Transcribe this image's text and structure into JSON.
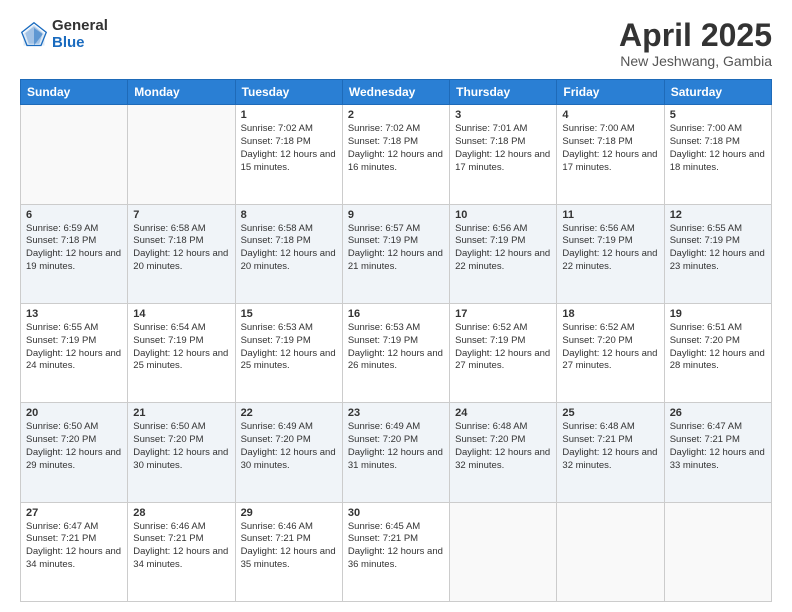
{
  "header": {
    "logo_general": "General",
    "logo_blue": "Blue",
    "month_title": "April 2025",
    "location": "New Jeshwang, Gambia"
  },
  "days_of_week": [
    "Sunday",
    "Monday",
    "Tuesday",
    "Wednesday",
    "Thursday",
    "Friday",
    "Saturday"
  ],
  "weeks": [
    [
      {
        "day": "",
        "sunrise": "",
        "sunset": "",
        "daylight": ""
      },
      {
        "day": "",
        "sunrise": "",
        "sunset": "",
        "daylight": ""
      },
      {
        "day": "1",
        "sunrise": "Sunrise: 7:02 AM",
        "sunset": "Sunset: 7:18 PM",
        "daylight": "Daylight: 12 hours and 15 minutes."
      },
      {
        "day": "2",
        "sunrise": "Sunrise: 7:02 AM",
        "sunset": "Sunset: 7:18 PM",
        "daylight": "Daylight: 12 hours and 16 minutes."
      },
      {
        "day": "3",
        "sunrise": "Sunrise: 7:01 AM",
        "sunset": "Sunset: 7:18 PM",
        "daylight": "Daylight: 12 hours and 17 minutes."
      },
      {
        "day": "4",
        "sunrise": "Sunrise: 7:00 AM",
        "sunset": "Sunset: 7:18 PM",
        "daylight": "Daylight: 12 hours and 17 minutes."
      },
      {
        "day": "5",
        "sunrise": "Sunrise: 7:00 AM",
        "sunset": "Sunset: 7:18 PM",
        "daylight": "Daylight: 12 hours and 18 minutes."
      }
    ],
    [
      {
        "day": "6",
        "sunrise": "Sunrise: 6:59 AM",
        "sunset": "Sunset: 7:18 PM",
        "daylight": "Daylight: 12 hours and 19 minutes."
      },
      {
        "day": "7",
        "sunrise": "Sunrise: 6:58 AM",
        "sunset": "Sunset: 7:18 PM",
        "daylight": "Daylight: 12 hours and 20 minutes."
      },
      {
        "day": "8",
        "sunrise": "Sunrise: 6:58 AM",
        "sunset": "Sunset: 7:18 PM",
        "daylight": "Daylight: 12 hours and 20 minutes."
      },
      {
        "day": "9",
        "sunrise": "Sunrise: 6:57 AM",
        "sunset": "Sunset: 7:19 PM",
        "daylight": "Daylight: 12 hours and 21 minutes."
      },
      {
        "day": "10",
        "sunrise": "Sunrise: 6:56 AM",
        "sunset": "Sunset: 7:19 PM",
        "daylight": "Daylight: 12 hours and 22 minutes."
      },
      {
        "day": "11",
        "sunrise": "Sunrise: 6:56 AM",
        "sunset": "Sunset: 7:19 PM",
        "daylight": "Daylight: 12 hours and 22 minutes."
      },
      {
        "day": "12",
        "sunrise": "Sunrise: 6:55 AM",
        "sunset": "Sunset: 7:19 PM",
        "daylight": "Daylight: 12 hours and 23 minutes."
      }
    ],
    [
      {
        "day": "13",
        "sunrise": "Sunrise: 6:55 AM",
        "sunset": "Sunset: 7:19 PM",
        "daylight": "Daylight: 12 hours and 24 minutes."
      },
      {
        "day": "14",
        "sunrise": "Sunrise: 6:54 AM",
        "sunset": "Sunset: 7:19 PM",
        "daylight": "Daylight: 12 hours and 25 minutes."
      },
      {
        "day": "15",
        "sunrise": "Sunrise: 6:53 AM",
        "sunset": "Sunset: 7:19 PM",
        "daylight": "Daylight: 12 hours and 25 minutes."
      },
      {
        "day": "16",
        "sunrise": "Sunrise: 6:53 AM",
        "sunset": "Sunset: 7:19 PM",
        "daylight": "Daylight: 12 hours and 26 minutes."
      },
      {
        "day": "17",
        "sunrise": "Sunrise: 6:52 AM",
        "sunset": "Sunset: 7:19 PM",
        "daylight": "Daylight: 12 hours and 27 minutes."
      },
      {
        "day": "18",
        "sunrise": "Sunrise: 6:52 AM",
        "sunset": "Sunset: 7:20 PM",
        "daylight": "Daylight: 12 hours and 27 minutes."
      },
      {
        "day": "19",
        "sunrise": "Sunrise: 6:51 AM",
        "sunset": "Sunset: 7:20 PM",
        "daylight": "Daylight: 12 hours and 28 minutes."
      }
    ],
    [
      {
        "day": "20",
        "sunrise": "Sunrise: 6:50 AM",
        "sunset": "Sunset: 7:20 PM",
        "daylight": "Daylight: 12 hours and 29 minutes."
      },
      {
        "day": "21",
        "sunrise": "Sunrise: 6:50 AM",
        "sunset": "Sunset: 7:20 PM",
        "daylight": "Daylight: 12 hours and 30 minutes."
      },
      {
        "day": "22",
        "sunrise": "Sunrise: 6:49 AM",
        "sunset": "Sunset: 7:20 PM",
        "daylight": "Daylight: 12 hours and 30 minutes."
      },
      {
        "day": "23",
        "sunrise": "Sunrise: 6:49 AM",
        "sunset": "Sunset: 7:20 PM",
        "daylight": "Daylight: 12 hours and 31 minutes."
      },
      {
        "day": "24",
        "sunrise": "Sunrise: 6:48 AM",
        "sunset": "Sunset: 7:20 PM",
        "daylight": "Daylight: 12 hours and 32 minutes."
      },
      {
        "day": "25",
        "sunrise": "Sunrise: 6:48 AM",
        "sunset": "Sunset: 7:21 PM",
        "daylight": "Daylight: 12 hours and 32 minutes."
      },
      {
        "day": "26",
        "sunrise": "Sunrise: 6:47 AM",
        "sunset": "Sunset: 7:21 PM",
        "daylight": "Daylight: 12 hours and 33 minutes."
      }
    ],
    [
      {
        "day": "27",
        "sunrise": "Sunrise: 6:47 AM",
        "sunset": "Sunset: 7:21 PM",
        "daylight": "Daylight: 12 hours and 34 minutes."
      },
      {
        "day": "28",
        "sunrise": "Sunrise: 6:46 AM",
        "sunset": "Sunset: 7:21 PM",
        "daylight": "Daylight: 12 hours and 34 minutes."
      },
      {
        "day": "29",
        "sunrise": "Sunrise: 6:46 AM",
        "sunset": "Sunset: 7:21 PM",
        "daylight": "Daylight: 12 hours and 35 minutes."
      },
      {
        "day": "30",
        "sunrise": "Sunrise: 6:45 AM",
        "sunset": "Sunset: 7:21 PM",
        "daylight": "Daylight: 12 hours and 36 minutes."
      },
      {
        "day": "",
        "sunrise": "",
        "sunset": "",
        "daylight": ""
      },
      {
        "day": "",
        "sunrise": "",
        "sunset": "",
        "daylight": ""
      },
      {
        "day": "",
        "sunrise": "",
        "sunset": "",
        "daylight": ""
      }
    ]
  ]
}
